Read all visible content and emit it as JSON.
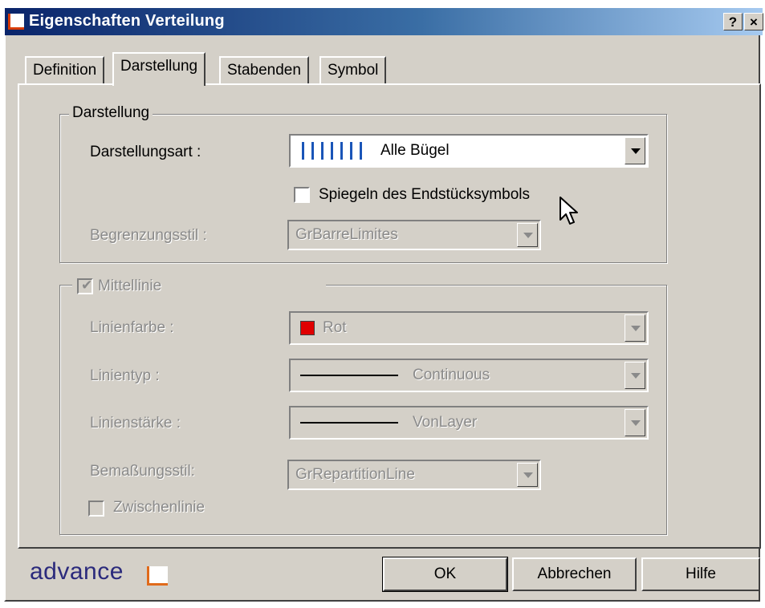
{
  "window": {
    "title": "Eigenschaften Verteilung",
    "help_button": "?",
    "close_button": "×"
  },
  "tabs": [
    {
      "label": "Definition"
    },
    {
      "label": "Darstellung"
    },
    {
      "label": "Stabenden"
    },
    {
      "label": "Symbol"
    }
  ],
  "darstellung_group": {
    "legend": "Darstellung",
    "darstellungsart_label": "Darstellungsart :",
    "darstellungsart_value": "Alle Bügel",
    "spiegeln_label": "Spiegeln des Endstücksymbols",
    "spiegeln_checked": false,
    "begrenzungsstil_label": "Begrenzungsstil :",
    "begrenzungsstil_value": "GrBarreLimites"
  },
  "mittellinie_group": {
    "checkbox_label": "Mittellinie",
    "checked": true,
    "linienfarbe_label": "Linienfarbe :",
    "linienfarbe_value": "Rot",
    "linienfarbe_color": "#e00000",
    "linientyp_label": "Linientyp :",
    "linientyp_value": "Continuous",
    "linienstaerke_label": "Linienstärke :",
    "linienstaerke_value": "VonLayer",
    "bemassungsstil_label": "Bemaßungsstil:",
    "bemassungsstil_value": "GrRepartitionLine",
    "zwischenlinie_label": "Zwischenlinie",
    "zwischenlinie_checked": false
  },
  "footer": {
    "brand": "advance",
    "ok_label": "OK",
    "cancel_label": "Abbrechen",
    "help_label": "Hilfe"
  },
  "colors": {
    "titlebar_start": "#0a246a",
    "titlebar_end": "#a6caf0",
    "dialog_bg": "#d4d0c8",
    "brand_text": "#2b2a7c",
    "brand_accent": "#e06a1b",
    "stripe_blue": "#1a55b8"
  }
}
